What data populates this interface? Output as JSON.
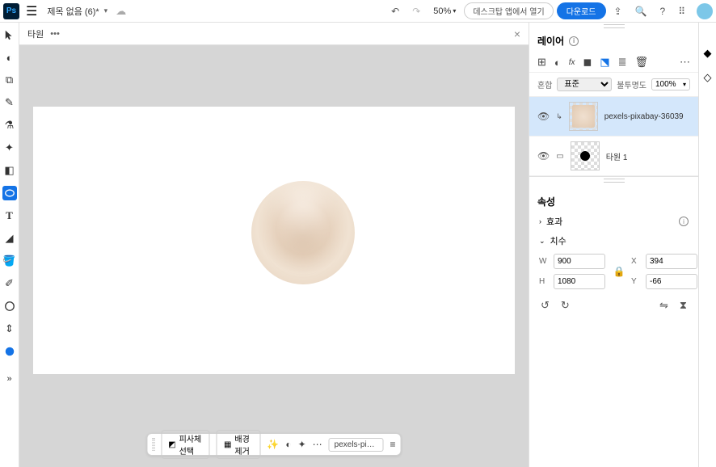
{
  "topbar": {
    "title": "제목 없음 (6)*",
    "zoom": "50%",
    "desktop_open": "데스크탑 앱에서 열기",
    "download": "다운로드"
  },
  "options": {
    "shape_label": "타원"
  },
  "bottom": {
    "subject_select": "피사체 선택",
    "remove_bg": "배경 제거",
    "layer_label": "pexels-pixabay-..."
  },
  "panels": {
    "layers_title": "레이어",
    "blend_label": "혼합",
    "blend_mode": "표준",
    "opacity_label": "불투명도",
    "opacity_value": "100%",
    "layer1_name": "pexels-pixabay-36039",
    "layer2_name": "타원 1",
    "props_title": "속성",
    "effects_label": "효과",
    "dimensions_label": "치수",
    "w_label": "W",
    "h_label": "H",
    "x_label": "X",
    "y_label": "Y",
    "w_value": "900",
    "h_value": "1080",
    "x_value": "394",
    "y_value": "-66"
  }
}
